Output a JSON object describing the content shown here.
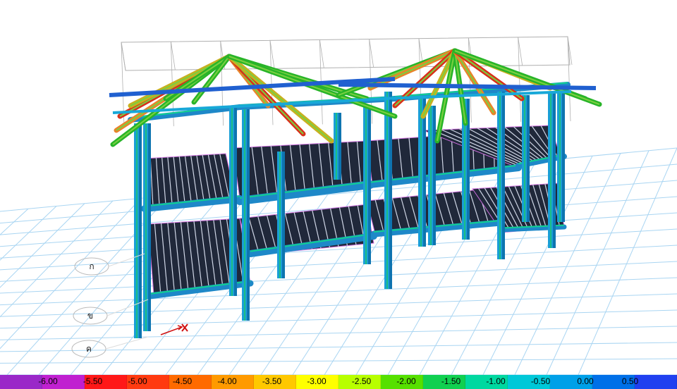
{
  "legend": {
    "colors": [
      "#9a28c8",
      "#c020d0",
      "#ff1818",
      "#ff3a10",
      "#ff6a00",
      "#ff9a00",
      "#ffc800",
      "#ffff00",
      "#b8ff00",
      "#56e000",
      "#10d050",
      "#00d8a0",
      "#00c8d8",
      "#00a0e8",
      "#0070e8",
      "#2040f0"
    ],
    "labels": [
      "-6.00",
      "-5.50",
      "-5.00",
      "-4.50",
      "-4.00",
      "-3.50",
      "-3.00",
      "-2.50",
      "-2.00",
      "-1.50",
      "-1.00",
      "-0.50",
      "0.00",
      "0.50"
    ]
  },
  "grid_bubbles": [
    "ก",
    "ข",
    "ค"
  ],
  "colors": {
    "column": "#1a9fd6",
    "column_shade": "#0e74b0",
    "beam": "#1e88c8",
    "slab_dark": "#20283a",
    "joist": "#cfd6e6",
    "ground_grid": "#a9d5f2",
    "wire": "#b0b0b0",
    "roof_green": "#28b428",
    "roof_orange": "#e8842a",
    "roof_red": "#d8301a"
  }
}
